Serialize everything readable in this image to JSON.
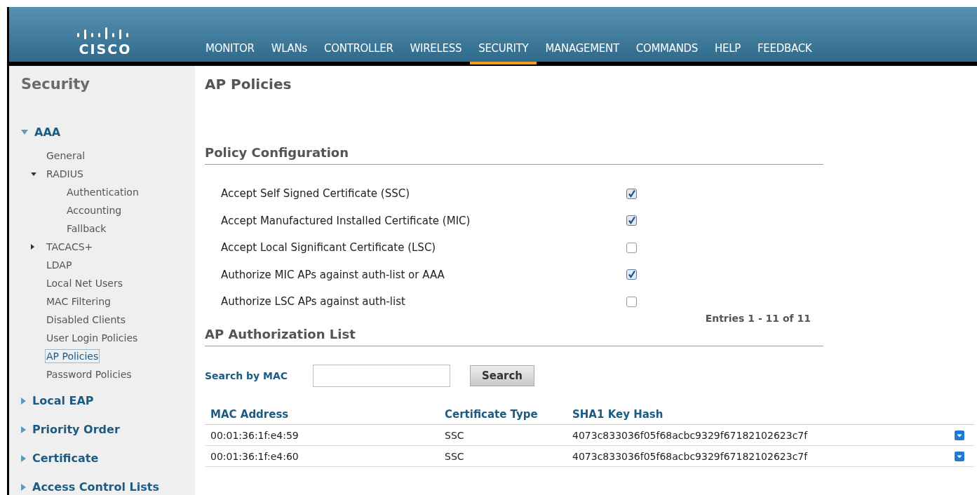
{
  "brand": {
    "name": "CISCO"
  },
  "nav": [
    {
      "label": "MONITOR",
      "selected": false
    },
    {
      "label": "WLANs",
      "selected": false
    },
    {
      "label": "CONTROLLER",
      "selected": false
    },
    {
      "label": "WIRELESS",
      "selected": false
    },
    {
      "label": "SECURITY",
      "selected": true
    },
    {
      "label": "MANAGEMENT",
      "selected": false
    },
    {
      "label": "COMMANDS",
      "selected": false
    },
    {
      "label": "HELP",
      "selected": false
    },
    {
      "label": "FEEDBACK",
      "selected": false
    }
  ],
  "sidebar": {
    "title": "Security",
    "items": [
      {
        "label": "AAA",
        "expanded": true,
        "children": [
          {
            "label": "General",
            "selected": false
          },
          {
            "label": "RADIUS",
            "expanded": true,
            "children": [
              {
                "label": "Authentication",
                "selected": false
              },
              {
                "label": "Accounting",
                "selected": false
              },
              {
                "label": "Fallback",
                "selected": false
              }
            ]
          },
          {
            "label": "TACACS+",
            "expanded": false
          },
          {
            "label": "LDAP",
            "selected": false
          },
          {
            "label": "Local Net Users",
            "selected": false
          },
          {
            "label": "MAC Filtering",
            "selected": false
          },
          {
            "label": "Disabled Clients",
            "selected": false
          },
          {
            "label": "User Login Policies",
            "selected": false
          },
          {
            "label": "AP Policies",
            "selected": true
          },
          {
            "label": "Password Policies",
            "selected": false
          }
        ]
      },
      {
        "label": "Local EAP",
        "expanded": false
      },
      {
        "label": "Priority Order",
        "expanded": false
      },
      {
        "label": "Certificate",
        "expanded": false
      },
      {
        "label": "Access Control Lists",
        "expanded": false
      }
    ]
  },
  "page_title": "AP Policies",
  "policy": {
    "heading": "Policy Configuration",
    "options": [
      {
        "label": "Accept Self Signed Certificate (SSC)",
        "checked": true
      },
      {
        "label": "Accept Manufactured Installed Certificate (MIC)",
        "checked": true
      },
      {
        "label": "Accept Local Significant Certificate (LSC)",
        "checked": false
      },
      {
        "label": "Authorize MIC APs against auth-list or AAA",
        "checked": true
      },
      {
        "label": "Authorize LSC APs against auth-list",
        "checked": false
      }
    ]
  },
  "auth_list": {
    "heading": "AP Authorization List",
    "entries": "Entries 1 - 11 of 11",
    "search_label": "Search by MAC",
    "search_button": "Search",
    "columns": [
      "MAC Address",
      "Certificate Type",
      "SHA1 Key Hash"
    ],
    "rows": [
      [
        "00:01:36:1f:e4:59",
        "SSC",
        "4073c833036f05f68acbc9329f67182102623c7f"
      ],
      [
        "00:01:36:1f:e4:60",
        "SSC",
        "4073c833036f05f68acbc9329f67182102623c7f"
      ]
    ]
  }
}
